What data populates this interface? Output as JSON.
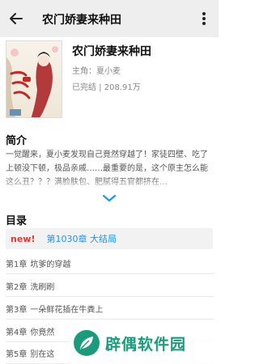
{
  "header": {
    "title": "农门娇妻来种田"
  },
  "book": {
    "title": "农门娇妻来种田",
    "author_line": "主角：夏小麦",
    "status_line": "已完结 | 208.91万",
    "cover_text": "娇妻来种田"
  },
  "intro": {
    "heading": "简介",
    "text": "一觉醒来，夏小麦发现自己竟然穿越了！家徒四壁、吃了上顿没下顿，极品亲戚……最重要的是，这个原主怎么能这么丑？？？满脸肤包、肥腻得五官都挤在…"
  },
  "toc": {
    "heading": "目录",
    "latest_tag": "new!",
    "latest_chapter": "第1030章  大结局",
    "chapters": [
      {
        "num": "第1章",
        "name": "坑爹的穿越"
      },
      {
        "num": "第2章",
        "name": "洗刷刷"
      },
      {
        "num": "第3章",
        "name": "一朵鲜花插在牛粪上"
      },
      {
        "num": "第4章",
        "name": "你竟然"
      },
      {
        "num": "第5章",
        "name": "别在这"
      }
    ]
  },
  "watermark": {
    "text": "辟偶软件园"
  },
  "colors": {
    "accent": "#2196f3",
    "new_tag": "#e53935",
    "watermark": "#1a9c7c"
  }
}
